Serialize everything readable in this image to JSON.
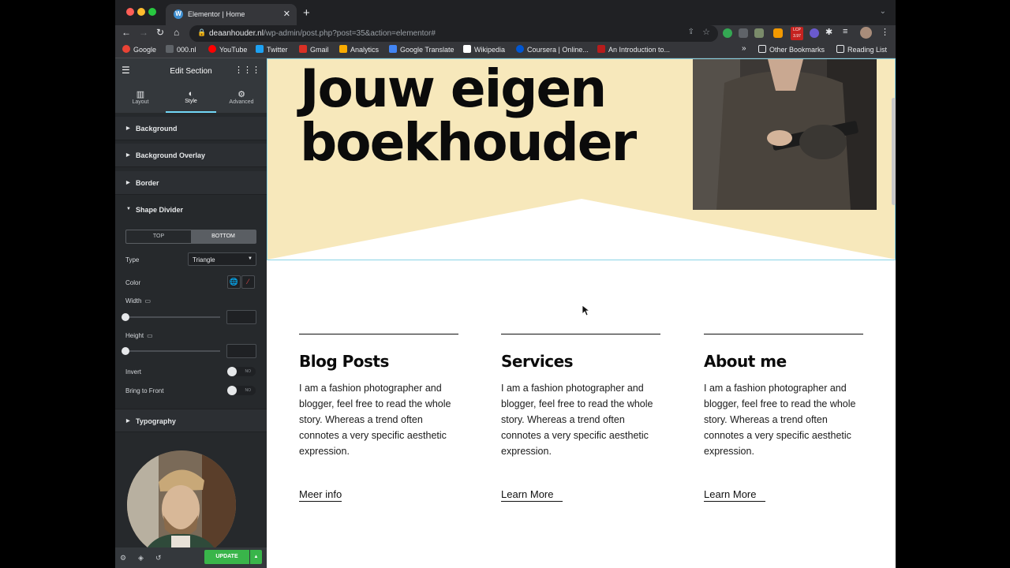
{
  "browser": {
    "tab_title": "Elementor | Home",
    "tab_favicon": "wordpress-icon",
    "url_domain": "deaanhouder.nl",
    "url_path": "/wp-admin/post.php?post=35&action=elementor#",
    "lcp_badge": "LCP",
    "lcp_value": "3.97",
    "bookmarks": [
      {
        "label": "Google",
        "color": "#ea4335"
      },
      {
        "label": "000.nl",
        "color": "#5f6368"
      },
      {
        "label": "YouTube",
        "color": "#ff0000"
      },
      {
        "label": "Twitter",
        "color": "#1da1f2"
      },
      {
        "label": "Gmail",
        "color": "#d93025"
      },
      {
        "label": "Analytics",
        "color": "#f9ab00"
      },
      {
        "label": "Google Translate",
        "color": "#4285f4"
      },
      {
        "label": "Wikipedia",
        "color": "#ffffff"
      },
      {
        "label": "Coursera | Online...",
        "color": "#0056d2"
      },
      {
        "label": "An Introduction to...",
        "color": "#b71c1c"
      }
    ],
    "bookmarks_more": "»",
    "other_bookmarks": "Other Bookmarks",
    "reading_list": "Reading List"
  },
  "panel": {
    "title": "Edit Section",
    "tabs": [
      {
        "label": "Layout",
        "icon": "columns-icon"
      },
      {
        "label": "Style",
        "icon": "half-circle-icon"
      },
      {
        "label": "Advanced",
        "icon": "gear-icon"
      }
    ],
    "sections": {
      "background": "Background",
      "background_overlay": "Background Overlay",
      "border": "Border",
      "shape_divider": "Shape Divider",
      "typography": "Typography"
    },
    "switcher": {
      "top": "TOP",
      "bottom": "BOTTOM"
    },
    "type_label": "Type",
    "type_value": "Triangle",
    "color_label": "Color",
    "width_label": "Width",
    "height_label": "Height",
    "invert_label": "Invert",
    "invert_state": "NO",
    "bring_front_label": "Bring to Front",
    "bring_front_state": "NO",
    "update_label": "UPDATE"
  },
  "hero": {
    "heading_line1": "Jouw eigen",
    "heading_line2": "boekhouder",
    "bg_color": "#f7e8bb"
  },
  "columns": [
    {
      "title": "Blog Posts",
      "body": "I am a fashion photographer and blogger, feel free to read the whole story. Whereas a trend often connotes a very specific aesthetic expression.",
      "link": "Meer info"
    },
    {
      "title": "Services",
      "body": "I am a fashion photographer and blogger, feel free to read the whole story. Whereas a trend often connotes a very specific aesthetic expression.",
      "link": "Learn More"
    },
    {
      "title": "About me",
      "body": "I am a fashion photographer and blogger, feel free to read the whole story. Whereas a trend often connotes a very specific aesthetic expression.",
      "link": "Learn More"
    }
  ]
}
